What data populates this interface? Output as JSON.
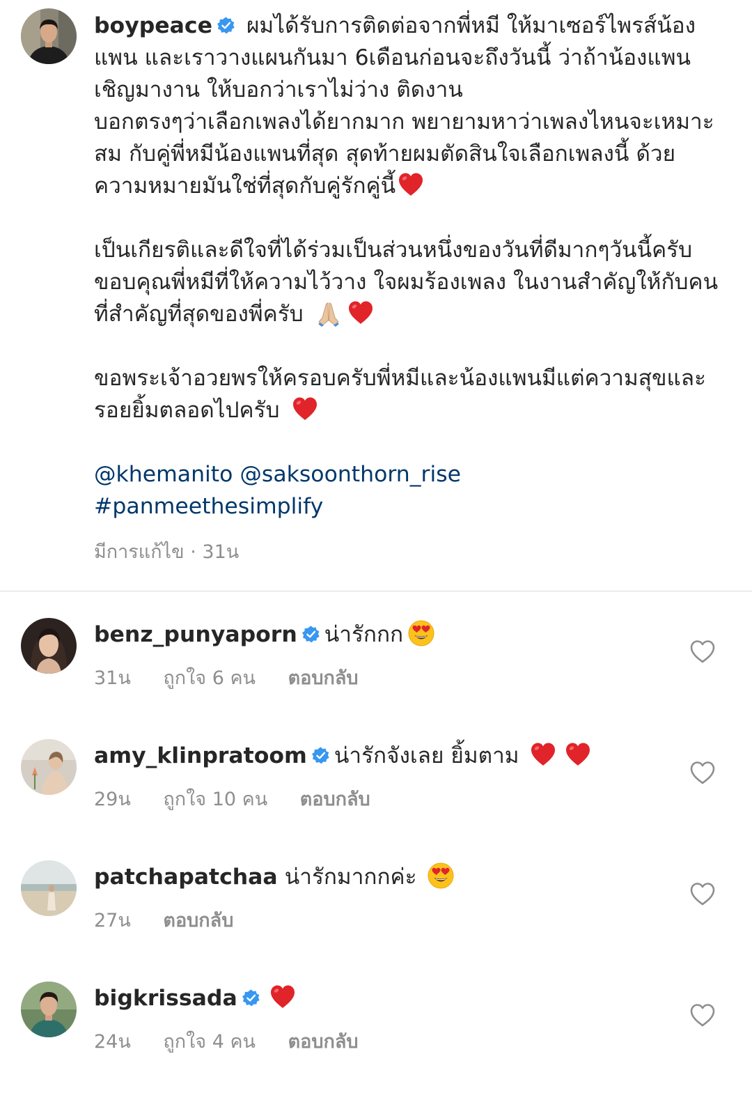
{
  "post": {
    "author": "boypeace",
    "avatar_icon": "profile-photo-man",
    "verified_icon": "verified-badge-icon",
    "paragraphs": [
      "ผมได้รับการติดต่อจากพี่หมี ให้มาเซอร์ไพรส์น้องแพน และเราวางแผนกันมา 6เดือนก่อนจะถึงวันนี้ ว่าถ้าน้องแพนเชิญมางาน ให้บอกว่าเราไม่ว่าง ติดงาน",
      "บอกตรงๆว่าเลือกเพลงได้ยากมาก พยายามหาว่าเพลงไหนจะเหมาะสม กับคู่พี่หมีน้องแพนที่สุด สุดท้ายผมตัดสินใจเลือกเพลงนี้ ด้วยความหมายมันใช่ที่สุดกับคู่รักคู่นี้",
      "เป็นเกียรติและดีใจที่ได้ร่วมเป็นส่วนหนึ่งของวันที่ดีมากๆวันนี้ครับ ขอบคุณพี่หมีที่ให้ความไว้วาง ใจผมร้องเพลง ในงานสำคัญให้กับคนที่สำคัญที่สุดของพี่ครับ",
      "ขอพระเจ้าอวยพรให้ครอบครับพี่หมีและน้องแพนมีแต่ความสุขและรอยยิ้มตลอดไปครับ"
    ],
    "mentions": "@khemanito @saksoonthorn_rise",
    "hashtag": "#panmeethesimplify",
    "edited_label": "มีการแก้ไข",
    "separator": "·",
    "time": "31น"
  },
  "comments": [
    {
      "username": "benz_punyaporn",
      "verified": true,
      "text": "น่ารักกก",
      "emoji": [
        "heart-eyes-emoji"
      ],
      "time": "31น",
      "likes": "ถูกใจ 6 คน",
      "reply": "ตอบกลับ",
      "avatar_color": "#3a2a24"
    },
    {
      "username": "amy_klinpratoom",
      "verified": true,
      "text": "น่ารักจังเลย ยิ้มตาม",
      "emoji": [
        "red-heart-emoji",
        "red-heart-emoji"
      ],
      "time": "29น",
      "likes": "ถูกใจ 10 คน",
      "reply": "ตอบกลับ",
      "avatar_color": "#cfc8bd"
    },
    {
      "username": "patchapatchaa",
      "verified": false,
      "text": "น่ารักมากกค่ะ",
      "emoji": [
        "heart-eyes-emoji"
      ],
      "time": "27น",
      "likes": "",
      "reply": "ตอบกลับ",
      "avatar_color": "#c9d2d0"
    },
    {
      "username": "bigkrissada",
      "verified": true,
      "text": "",
      "emoji": [
        "red-heart-emoji"
      ],
      "time": "24น",
      "likes": "ถูกใจ 4 คน",
      "reply": "ตอบกลับ",
      "avatar_color": "#4e6b4a"
    }
  ],
  "like_icon": "heart-outline-icon",
  "colors": {
    "text": "#262626",
    "meta": "#8e8e8e",
    "link": "#00376b",
    "verified": "#3897f0",
    "divider": "#dbdbdb",
    "heart": "#e0242a"
  }
}
